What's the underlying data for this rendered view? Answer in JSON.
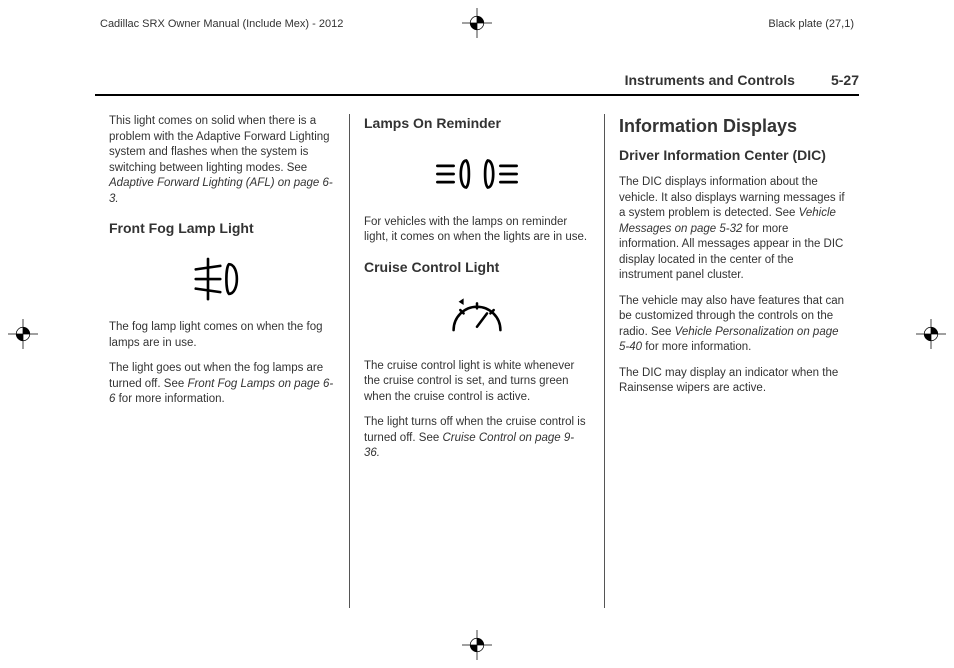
{
  "meta": {
    "doc_title": "Cadillac SRX Owner Manual (Include Mex) - 2012",
    "plate": "Black plate (27,1)"
  },
  "header": {
    "chapter": "Instruments and Controls",
    "pagenum": "5-27"
  },
  "col1": {
    "afl_note": "This light comes on solid when there is a problem with the Adaptive Forward Lighting system and flashes when the system is switching between lighting modes. See ",
    "afl_ref": "Adaptive Forward Lighting (AFL) on page 6-3.",
    "fog_heading": "Front Fog Lamp Light",
    "fog_p1": "The fog lamp light comes on when the fog lamps are in use.",
    "fog_p2a": "The light goes out when the fog lamps are turned off. See ",
    "fog_ref": "Front Fog Lamps on page 6-6",
    "fog_p2b": " for more information."
  },
  "col2": {
    "lamps_heading": "Lamps On Reminder",
    "lamps_p": "For vehicles with the lamps on reminder light, it comes on when the lights are in use.",
    "cruise_heading": "Cruise Control Light",
    "cruise_p1": "The cruise control light is white whenever the cruise control is set, and turns green when the cruise control is active.",
    "cruise_p2a": "The light turns off when the cruise control is turned off. See ",
    "cruise_ref": "Cruise Control on page 9-36.",
    "cruise_p2b": ""
  },
  "col3": {
    "info_heading": "Information Displays",
    "dic_heading": "Driver Information Center (DIC)",
    "dic_p1a": "The DIC displays information about the vehicle. It also displays warning messages if a system problem is detected. See ",
    "dic_ref1": "Vehicle Messages on page 5-32",
    "dic_p1b": " for more information. All messages appear in the DIC display located in the center of the instrument panel cluster.",
    "dic_p2a": "The vehicle may also have features that can be customized through the controls on the radio. See ",
    "dic_ref2": "Vehicle Personalization on page 5-40",
    "dic_p2b": " for more information.",
    "dic_p3": "The DIC may display an indicator when the Rainsense wipers are active."
  }
}
